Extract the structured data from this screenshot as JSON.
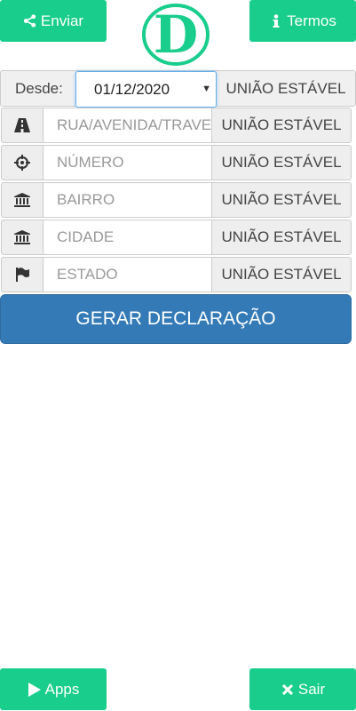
{
  "header": {
    "share_label": "Enviar",
    "terms_label": "Termos",
    "logo_letter": "D",
    "brand_color": "#19cd8c"
  },
  "date_row": {
    "label": "Desde:",
    "selected_date": "01/12/2020",
    "addon": "UNIÃO ESTÁVEL"
  },
  "fields": [
    {
      "icon": "road-icon",
      "placeholder": "RUA/AVENIDA/TRAVESSA",
      "addon": "UNIÃO ESTÁVEL"
    },
    {
      "icon": "crosshairs-icon",
      "placeholder": "NÚMERO",
      "addon": "UNIÃO ESTÁVEL"
    },
    {
      "icon": "bank-icon",
      "placeholder": "BAIRRO",
      "addon": "UNIÃO ESTÁVEL"
    },
    {
      "icon": "bank-icon",
      "placeholder": "CIDADE",
      "addon": "UNIÃO ESTÁVEL"
    },
    {
      "icon": "flag-icon",
      "placeholder": "ESTADO",
      "addon": "UNIÃO ESTÁVEL"
    }
  ],
  "generate_label": "GERAR DECLARAÇÃO",
  "footer": {
    "apps_label": "Apps",
    "exit_label": "Sair"
  },
  "colors": {
    "accent": "#19cd8c",
    "primary_button": "#337ab7"
  }
}
